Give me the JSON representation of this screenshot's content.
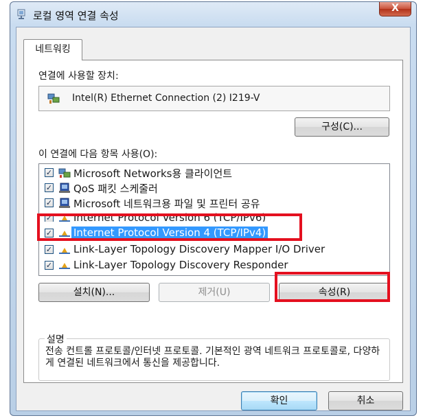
{
  "window": {
    "title": "로컬 영역 연결 속성",
    "close_label": "X"
  },
  "tabs": [
    {
      "label": "네트워킹"
    }
  ],
  "connection": {
    "connect_using_label": "연결에 사용할 장치:",
    "device_name": "Intel(R) Ethernet Connection (2) I219-V",
    "configure_label": "구성(C)..."
  },
  "items_section": {
    "label": "이 연결에 다음 항목 사용(O):",
    "items": [
      {
        "label": "Microsoft Networks용 클라이언트",
        "checked": true,
        "icon": "network-client-icon"
      },
      {
        "label": "QoS 패킷 스케줄러",
        "checked": true,
        "icon": "qos-service-icon"
      },
      {
        "label": "Microsoft 네트워크용 파일 및 프린터 공유",
        "checked": true,
        "icon": "file-printer-sharing-icon"
      },
      {
        "label": "Internet Protocol Version 6 (TCP/IPv6)",
        "checked": true,
        "icon": "protocol-icon"
      },
      {
        "label": "Internet Protocol Version 4 (TCP/IPv4)",
        "checked": true,
        "icon": "protocol-icon",
        "selected": true
      },
      {
        "label": "Link-Layer Topology Discovery Mapper I/O Driver",
        "checked": true,
        "icon": "protocol-icon"
      },
      {
        "label": "Link-Layer Topology Discovery Responder",
        "checked": true,
        "icon": "protocol-icon"
      }
    ]
  },
  "actions": {
    "install_label": "설치(N)...",
    "uninstall_label": "제거(U)",
    "properties_label": "속성(R)"
  },
  "description": {
    "title": "설명",
    "text": "전송 컨트롤 프로토콜/인터넷 프로토콜. 기본적인 광역 네트워크 프로토콜로, 다양하게 연결된 네트워크에서 통신을 제공합니다."
  },
  "footer": {
    "ok_label": "확인",
    "cancel_label": "취소"
  },
  "colors": {
    "selection": "#3399ff",
    "annotation_red": "#e4101f",
    "close_button": "#c9513a"
  }
}
